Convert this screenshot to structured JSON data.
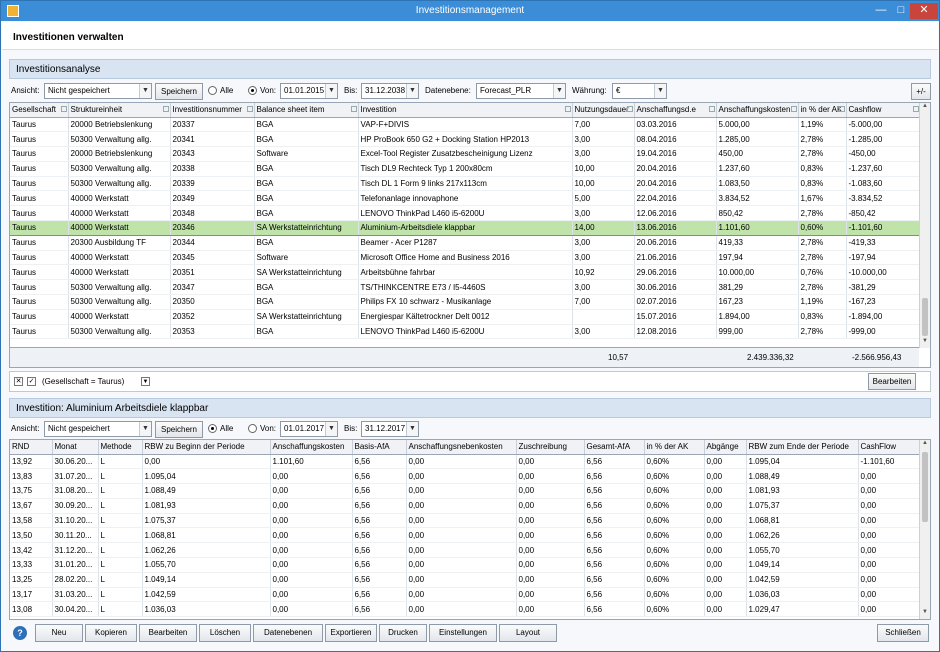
{
  "window": {
    "title": "Investitionsmanagement"
  },
  "header": {
    "title": "Investitionen verwalten"
  },
  "panel1": {
    "title": "Investitionsanalyse",
    "toolbar": {
      "ansicht_label": "Ansicht:",
      "ansicht_value": "Nicht gespeichert",
      "speichern": "Speichern",
      "alle": "Alle",
      "von_label": "Von:",
      "von_value": "01.01.2015",
      "bis_label": "Bis:",
      "bis_value": "31.12.2038",
      "datenebene_label": "Datenebene:",
      "datenebene_value": "Forecast_PLR",
      "waehrung_label": "Währung:",
      "waehrung_value": "€",
      "plusminus": "+/-"
    },
    "columns": [
      "Gesellschaft",
      "Struktureinheit",
      "Investitionsnummer",
      "Balance sheet item",
      "Investition",
      "Nutzungsdauer",
      "Anschaffungsd.e",
      "Anschaffungskosten",
      "in % der AK",
      "Cashflow"
    ],
    "rows": [
      [
        "Taurus",
        "20000 Betriebslenkung",
        "20337",
        "BGA",
        "VAP-F+DIVIS",
        "7,00",
        "03.03.2016",
        "5.000,00",
        "1,19%",
        "-5.000,00"
      ],
      [
        "Taurus",
        "50300 Verwaltung allg.",
        "20341",
        "BGA",
        "HP ProBook 650 G2 + Docking Station HP2013",
        "3,00",
        "08.04.2016",
        "1.285,00",
        "2,78%",
        "-1.285,00"
      ],
      [
        "Taurus",
        "20000 Betriebslenkung",
        "20343",
        "Software",
        "Excel-Tool Register Zusatzbescheinigung Lizenz",
        "3,00",
        "19.04.2016",
        "450,00",
        "2,78%",
        "-450,00"
      ],
      [
        "Taurus",
        "50300 Verwaltung allg.",
        "20338",
        "BGA",
        "Tisch DL9 Rechteck Typ 1 200x80cm",
        "10,00",
        "20.04.2016",
        "1.237,60",
        "0,83%",
        "-1.237,60"
      ],
      [
        "Taurus",
        "50300 Verwaltung allg.",
        "20339",
        "BGA",
        "Tisch DL 1 Form 9 links 217x113cm",
        "10,00",
        "20.04.2016",
        "1.083,50",
        "0,83%",
        "-1.083,60"
      ],
      [
        "Taurus",
        "40000 Werkstatt",
        "20349",
        "BGA",
        "Telefonanlage innovaphone",
        "5,00",
        "22.04.2016",
        "3.834,52",
        "1,67%",
        "-3.834,52"
      ],
      [
        "Taurus",
        "40000 Werkstatt",
        "20348",
        "BGA",
        "LENOVO ThinkPad L460 i5-6200U",
        "3,00",
        "12.06.2016",
        "850,42",
        "2,78%",
        "-850,42"
      ],
      [
        "Taurus",
        "40000 Werkstatt",
        "20346",
        "SA Werkstatteinrichtung",
        "Aluminium-Arbeitsdiele klappbar",
        "14,00",
        "13.06.2016",
        "1.101,60",
        "0,60%",
        "-1.101,60"
      ],
      [
        "Taurus",
        "20300 Ausbildung TF",
        "20344",
        "BGA",
        "Beamer - Acer P1287",
        "3,00",
        "20.06.2016",
        "419,33",
        "2,78%",
        "-419,33"
      ],
      [
        "Taurus",
        "40000 Werkstatt",
        "20345",
        "Software",
        "Microsoft Office Home and Business 2016",
        "3,00",
        "21.06.2016",
        "197,94",
        "2,78%",
        "-197,94"
      ],
      [
        "Taurus",
        "40000 Werkstatt",
        "20351",
        "SA Werkstatteinrichtung",
        "Arbeitsbühne fahrbar",
        "10,92",
        "29.06.2016",
        "10.000,00",
        "0,76%",
        "-10.000,00"
      ],
      [
        "Taurus",
        "50300 Verwaltung allg.",
        "20347",
        "BGA",
        "TS/THINKCENTRE E73 / I5-4460S",
        "3,00",
        "30.06.2016",
        "381,29",
        "2,78%",
        "-381,29"
      ],
      [
        "Taurus",
        "50300 Verwaltung allg.",
        "20350",
        "BGA",
        "Philips FX 10 schwarz - Musikanlage",
        "7,00",
        "02.07.2016",
        "167,23",
        "1,19%",
        "-167,23"
      ],
      [
        "Taurus",
        "40000 Werkstatt",
        "20352",
        "SA Werkstatteinrichtung",
        "Energiespar Kältetrockner Delt 0012",
        "",
        "15.07.2016",
        "1.894,00",
        "0,83%",
        "-1.894,00"
      ],
      [
        "Taurus",
        "50300 Verwaltung allg.",
        "20353",
        "BGA",
        "LENOVO ThinkPad L460 i5-6200U",
        "3,00",
        "12.08.2016",
        "999,00",
        "2,78%",
        "-999,00"
      ]
    ],
    "selected_row": 7,
    "summary": {
      "nutzung": "10,57",
      "kosten": "2.439.336,32",
      "cashflow": "-2.566.956,43"
    },
    "filter_text": "(Gesellschaft = Taurus)",
    "filter_button": "Bearbeiten"
  },
  "panel2": {
    "title": "Investition: Aluminium Arbeitsdiele klappbar",
    "toolbar": {
      "ansicht_label": "Ansicht:",
      "ansicht_value": "Nicht gespeichert",
      "speichern": "Speichern",
      "alle": "Alle",
      "von_label": "Von:",
      "von_value": "01.01.2017",
      "bis_label": "Bis:",
      "bis_value": "31.12.2017"
    },
    "columns": [
      "RND",
      "Monat",
      "Methode",
      "RBW zu Beginn der Periode",
      "Anschaffungskosten",
      "Basis-AfA",
      "Anschaffungsnebenkosten",
      "Zuschreibung",
      "Gesamt-AfA",
      "in % der AK",
      "Abgänge",
      "RBW zum Ende der Periode",
      "CashFlow"
    ],
    "rows": [
      [
        "13,92",
        "30.06.20...",
        "L",
        "0,00",
        "1.101,60",
        "6,56",
        "0,00",
        "0,00",
        "6,56",
        "0,60%",
        "0,00",
        "1.095,04",
        "-1.101,60"
      ],
      [
        "13,83",
        "31.07.20...",
        "L",
        "1.095,04",
        "0,00",
        "6,56",
        "0,00",
        "0,00",
        "6,56",
        "0,60%",
        "0,00",
        "1.088,49",
        "0,00"
      ],
      [
        "13,75",
        "31.08.20...",
        "L",
        "1.088,49",
        "0,00",
        "6,56",
        "0,00",
        "0,00",
        "6,56",
        "0,60%",
        "0,00",
        "1.081,93",
        "0,00"
      ],
      [
        "13,67",
        "30.09.20...",
        "L",
        "1.081,93",
        "0,00",
        "6,56",
        "0,00",
        "0,00",
        "6,56",
        "0,60%",
        "0,00",
        "1.075,37",
        "0,00"
      ],
      [
        "13,58",
        "31.10.20...",
        "L",
        "1.075,37",
        "0,00",
        "6,56",
        "0,00",
        "0,00",
        "6,56",
        "0,60%",
        "0,00",
        "1.068,81",
        "0,00"
      ],
      [
        "13,50",
        "30.11.20...",
        "L",
        "1.068,81",
        "0,00",
        "6,56",
        "0,00",
        "0,00",
        "6,56",
        "0,60%",
        "0,00",
        "1.062,26",
        "0,00"
      ],
      [
        "13,42",
        "31.12.20...",
        "L",
        "1.062,26",
        "0,00",
        "6,56",
        "0,00",
        "0,00",
        "6,56",
        "0,60%",
        "0,00",
        "1.055,70",
        "0,00"
      ],
      [
        "13,33",
        "31.01.20...",
        "L",
        "1.055,70",
        "0,00",
        "6,56",
        "0,00",
        "0,00",
        "6,56",
        "0,60%",
        "0,00",
        "1.049,14",
        "0,00"
      ],
      [
        "13,25",
        "28.02.20...",
        "L",
        "1.049,14",
        "0,00",
        "6,56",
        "0,00",
        "0,00",
        "6,56",
        "0,60%",
        "0,00",
        "1.042,59",
        "0,00"
      ],
      [
        "13,17",
        "31.03.20...",
        "L",
        "1.042,59",
        "0,00",
        "6,56",
        "0,00",
        "0,00",
        "6,56",
        "0,60%",
        "0,00",
        "1.036,03",
        "0,00"
      ],
      [
        "13,08",
        "30.04.20...",
        "L",
        "1.036,03",
        "0,00",
        "6,56",
        "0,00",
        "0,00",
        "6,56",
        "0,60%",
        "0,00",
        "1.029,47",
        "0,00"
      ]
    ]
  },
  "bottom": {
    "help": "?",
    "buttons": [
      "Neu",
      "Kopieren",
      "Bearbeiten",
      "Löschen",
      "Datenebenen",
      "Exportieren",
      "Drucken",
      "Einstellungen",
      "Layout"
    ],
    "close": "Schließen"
  }
}
